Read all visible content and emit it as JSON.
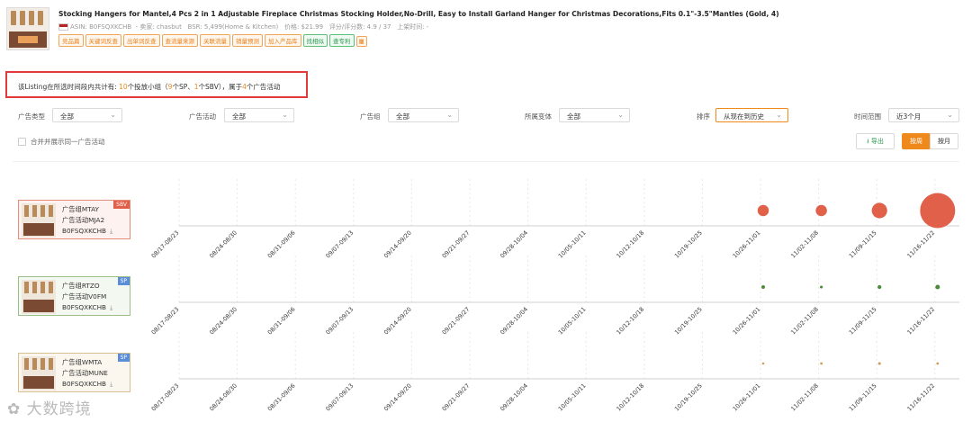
{
  "product": {
    "title": "Stocking Hangers for Mantel,4 Pcs 2 in 1 Adjustable Fireplace Christmas Stocking Holder,No-Drill, Easy to Install Garland Hanger for Christmas Decorations,Fits 0.1\"-3.5\"Mantles (Gold, 4)",
    "asin_label": "ASIN: B0FSQXKCHB",
    "seller": "- 卖家: chasbut",
    "bsr": "BSR: 5,499(Home & Kitchen)",
    "price": "价格: $21.99",
    "rating": "评分/评分数: 4.9 / 37",
    "launch": "上架时间: -",
    "tags": [
      "竞品篇",
      "关键词反查",
      "出单词反查",
      "查流量来源",
      "关联流量",
      "销量预测",
      "加入产品库",
      "找相似",
      "查专利"
    ]
  },
  "summary": {
    "pre": "该Listing在所选时间段内共计有: ",
    "groups": "10",
    "mid1": "个投放小组（",
    "sp": "9",
    "mid2": "个SP、",
    "sbv": "1",
    "mid3": "个SBV），属于",
    "campaigns": "4",
    "post": "个广告活动"
  },
  "filters": {
    "ad_type_label": "广告类型",
    "ad_type_value": "全部",
    "campaign_label": "广告活动",
    "campaign_value": "全部",
    "group_label": "广告组",
    "group_value": "全部",
    "variant_label": "所属变体",
    "variant_value": "全部",
    "sort_label": "排序",
    "sort_value": "从现在到历史",
    "range_label": "时间范围",
    "range_value": "近3个月",
    "merge_label": "合并并展示同一广告活动",
    "export_label": "导出",
    "by_week": "按周",
    "by_month": "按月"
  },
  "x_ticks": [
    "08/17-08/23",
    "08/24-08/30",
    "08/31-09/06",
    "09/07-09/13",
    "09/14-09/20",
    "09/21-09/27",
    "09/28-10/04",
    "10/05-10/11",
    "10/12-10/18",
    "10/19-10/25",
    "10/26-11/01",
    "11/02-11/08",
    "11/09-11/15",
    "11/16-11/22"
  ],
  "rows": [
    {
      "badge": "SBV",
      "group": "广告组MTAY",
      "campaign": "广告活动MJA2",
      "asin": "B0FSQXKCHB",
      "color": "#e0604a",
      "card_border": "#e58b7a",
      "card_bg": "#fdf2ef",
      "badge_color": "#e0604a",
      "values": [
        0,
        0,
        0,
        0,
        0,
        0,
        0,
        0,
        0,
        0,
        0.16,
        0.16,
        0.22,
        0.5
      ]
    },
    {
      "badge": "SP",
      "group": "广告组RTZO",
      "campaign": "广告活动V0FM",
      "asin": "B0FSQXKCHB",
      "color": "#4c8a3c",
      "card_border": "#9bbf8a",
      "card_bg": "#f3f8f0",
      "badge_color": "#5a8fd8",
      "values": [
        0,
        0,
        0,
        0,
        0,
        0,
        0,
        0,
        0,
        0,
        0.05,
        0.04,
        0.055,
        0.065
      ]
    },
    {
      "badge": "SP",
      "group": "广告组WMTA",
      "campaign": "广告活动MUNE",
      "asin": "B0FSQXKCHB",
      "color": "#c9a05a",
      "card_border": "#d6c08f",
      "card_bg": "#fbf7ee",
      "badge_color": "#5a8fd8",
      "values": [
        0,
        0,
        0,
        0,
        0,
        0,
        0,
        0,
        0,
        0,
        0.02,
        0.035,
        0.04,
        0.035
      ]
    }
  ],
  "watermark": "大数跨境"
}
